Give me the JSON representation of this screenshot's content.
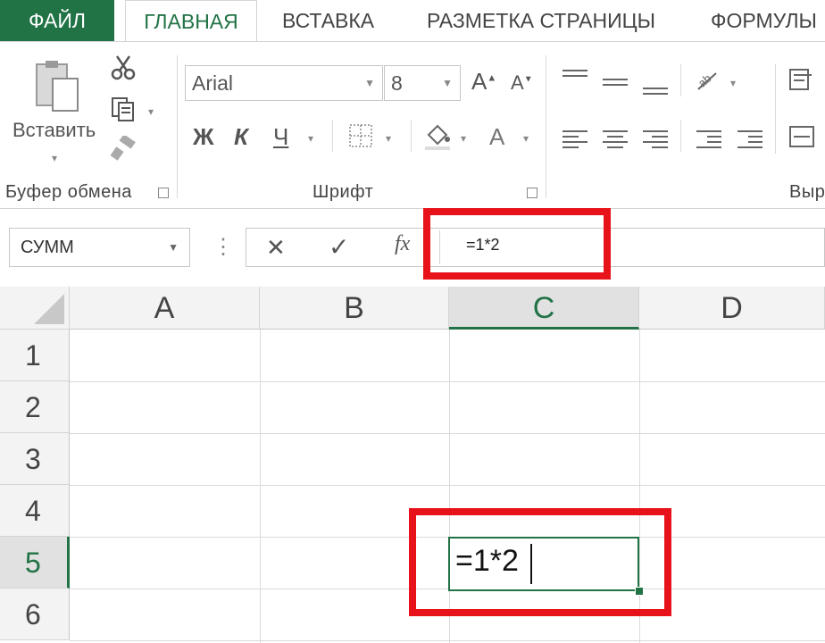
{
  "tabs": {
    "file": "ФАЙЛ",
    "home": "ГЛАВНАЯ",
    "insert": "ВСТАВКА",
    "page_layout": "РАЗМЕТКА СТРАНИЦЫ",
    "formulas": "ФОРМУЛЫ"
  },
  "clipboard": {
    "paste_label": "Вставить",
    "group_label": "Буфер обмена"
  },
  "font": {
    "name": "Arial",
    "size": "8",
    "grow": "A",
    "shrink": "A",
    "bold": "Ж",
    "italic": "К",
    "underline": "Ч",
    "font_color": "A",
    "group_label": "Шрифт"
  },
  "alignment": {
    "group_label_partial": "Выр"
  },
  "formula_bar": {
    "name_box": "СУММ",
    "separator": "⋮",
    "cancel": "✕",
    "enter": "✓",
    "fx": "fx",
    "formula": "=1*2"
  },
  "grid": {
    "columns": [
      "A",
      "B",
      "C",
      "D"
    ],
    "rows": [
      "1",
      "2",
      "3",
      "4",
      "5",
      "6"
    ],
    "selected_column": "C",
    "selected_row": "5",
    "active_cell_text": "=1*2"
  },
  "colors": {
    "accent": "#217346",
    "highlight": "#e8121a"
  }
}
